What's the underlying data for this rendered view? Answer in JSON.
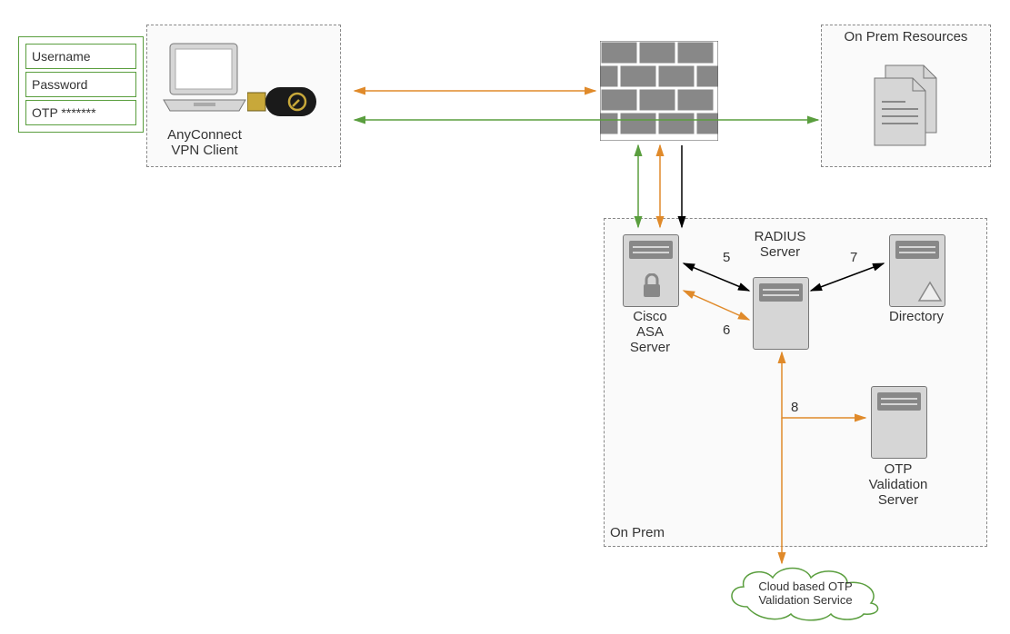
{
  "credentials": {
    "username": "Username",
    "password": "Password",
    "otp": "OTP *******"
  },
  "client": {
    "label": "AnyConnect\nVPN Client"
  },
  "resources": {
    "title": "On Prem Resources"
  },
  "onprem": {
    "label": "On Prem"
  },
  "servers": {
    "asa": "Cisco\nASA\nServer",
    "radius": "RADIUS\nServer",
    "directory": "Directory",
    "otpval": "OTP\nValidation\nServer"
  },
  "cloud": {
    "label": "Cloud based OTP\nValidation Service"
  },
  "steps": {
    "s5": "5",
    "s6": "6",
    "s7": "7",
    "s8": "8"
  }
}
